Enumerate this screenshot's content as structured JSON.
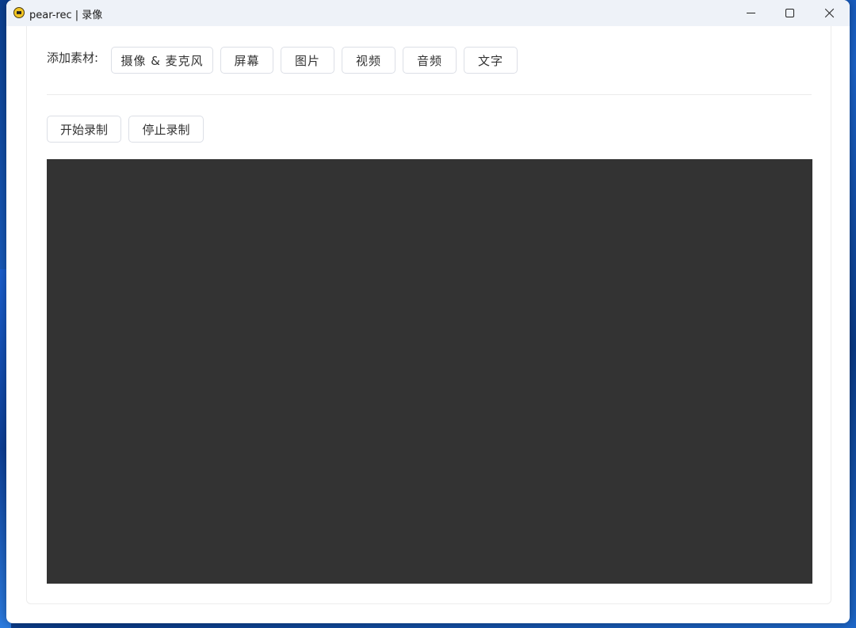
{
  "window": {
    "title": "pear-rec | 录像"
  },
  "sources": {
    "label": "添加素材:",
    "buttons": [
      {
        "label": "摄像 & 麦克风"
      },
      {
        "label": "屏幕"
      },
      {
        "label": "图片"
      },
      {
        "label": "视频"
      },
      {
        "label": "音频"
      },
      {
        "label": "文字"
      }
    ]
  },
  "recording": {
    "start_label": "开始录制",
    "stop_label": "停止录制"
  },
  "colors": {
    "preview_bg": "#333333",
    "titlebar_bg": "#eef2f8"
  }
}
